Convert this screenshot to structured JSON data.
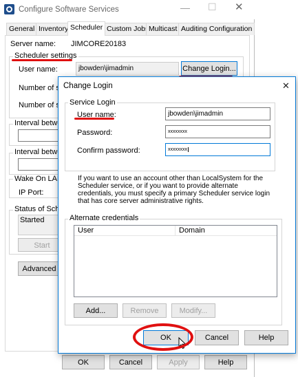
{
  "main_window": {
    "title": "Configure Software Services",
    "tabs": [
      "General",
      "Inventory",
      "Scheduler",
      "Custom Jobs",
      "Multicast",
      "Auditing Configuration"
    ],
    "server_name_label": "Server name:",
    "server_name_value": "JIMCORE20183",
    "scheduler_settings_label": "Scheduler settings",
    "user_name_label": "User name:",
    "user_name_value": "jbowden\\jimadmin",
    "change_login_label": "Change Login...",
    "number_sec_label_1": "Number of sec",
    "number_sec_label_2": "Number of sec",
    "interval_between_label_1": "Interval betwee",
    "interval_between_label_2": "Interval betwee",
    "wake_on_lan_label": "Wake On LAN",
    "ip_port_label": "IP Port:",
    "status_label": "Status of Sche",
    "status_value": "Started",
    "start_label": "Start",
    "advanced_label": "Advanced",
    "buttons": {
      "ok": "OK",
      "cancel": "Cancel",
      "apply": "Apply",
      "help": "Help"
    }
  },
  "dialog": {
    "title": "Change Login",
    "close_glyph": "✕",
    "service_login_label": "Service Login",
    "user_name_label": "User name:",
    "user_name_value": "jbowden\\jimadmin",
    "password_label": "Password:",
    "password_value": "xxxxxxxx",
    "confirm_label": "Confirm password:",
    "confirm_value": "xxxxxxxx",
    "info_text": "If you want to use an account other than LocalSystem for the Scheduler service, or if you want to provide alternate credentials, you must specify a primary Scheduler service login that has core server administrative rights.",
    "alternate_credentials_label": "Alternate credentials",
    "columns": [
      "User",
      "Domain"
    ],
    "add_label": "Add...",
    "remove_label": "Remove",
    "modify_label": "Modify...",
    "ok_label": "OK",
    "cancel_label": "Cancel",
    "help_label": "Help"
  },
  "colors": {
    "annotation_red": "#e01010",
    "accent_blue": "#0078d7"
  }
}
